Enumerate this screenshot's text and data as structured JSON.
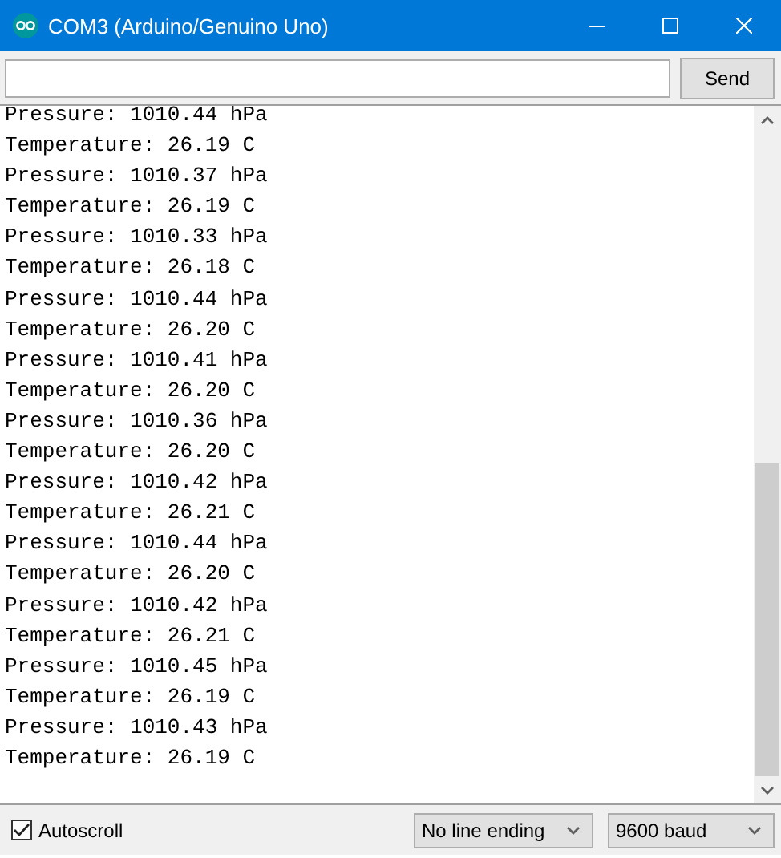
{
  "window": {
    "title": "COM3 (Arduino/Genuino Uno)"
  },
  "send": {
    "button": "Send"
  },
  "output": {
    "lines": [
      "Pressure: 1010.44 hPa",
      "Temperature: 26.19 C",
      "Pressure: 1010.37 hPa",
      "Temperature: 26.19 C",
      "Pressure: 1010.33 hPa",
      "Temperature: 26.18 C",
      "Pressure: 1010.44 hPa",
      "Temperature: 26.20 C",
      "Pressure: 1010.41 hPa",
      "Temperature: 26.20 C",
      "Pressure: 1010.36 hPa",
      "Temperature: 26.20 C",
      "Pressure: 1010.42 hPa",
      "Temperature: 26.21 C",
      "Pressure: 1010.44 hPa",
      "Temperature: 26.20 C",
      "Pressure: 1010.42 hPa",
      "Temperature: 26.21 C",
      "Pressure: 1010.45 hPa",
      "Temperature: 26.19 C",
      "Pressure: 1010.43 hPa",
      "Temperature: 26.19 C"
    ]
  },
  "status_bar": {
    "autoscroll": {
      "label": "Autoscroll",
      "checked": true
    },
    "line_ending": "No line ending",
    "baud": "9600 baud"
  }
}
